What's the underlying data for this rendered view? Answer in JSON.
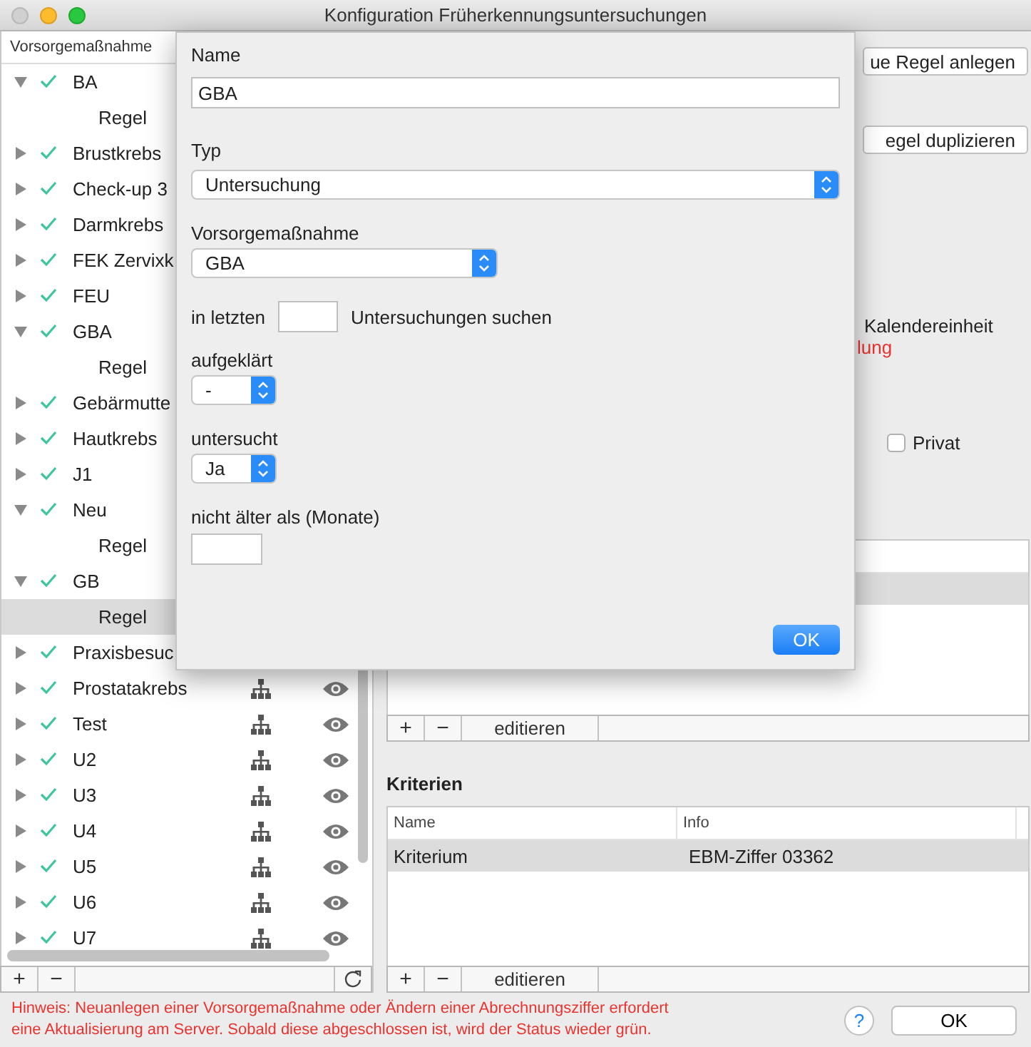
{
  "window": {
    "title": "Konfiguration Früherkennungsuntersuchungen"
  },
  "tree": {
    "column": "Vorsorgemaßnahme",
    "items": [
      {
        "label": "BA",
        "checked": true,
        "expanded": true,
        "selected": false,
        "icons": false,
        "children": [
          {
            "label": "Regel",
            "selected": false
          }
        ]
      },
      {
        "label": "Brustkrebs",
        "checked": true,
        "expanded": false,
        "selected": false,
        "icons": false
      },
      {
        "label": "Check-up 3",
        "checked": true,
        "expanded": false,
        "selected": false,
        "icons": false
      },
      {
        "label": "Darmkrebs",
        "checked": true,
        "expanded": false,
        "selected": false,
        "icons": false
      },
      {
        "label": "FEK Zervixk",
        "checked": true,
        "expanded": false,
        "selected": false,
        "icons": false
      },
      {
        "label": "FEU",
        "checked": true,
        "expanded": false,
        "selected": false,
        "icons": false
      },
      {
        "label": "GBA",
        "checked": true,
        "expanded": true,
        "selected": false,
        "icons": false,
        "children": [
          {
            "label": "Regel",
            "selected": false
          }
        ]
      },
      {
        "label": "Gebärmutte",
        "checked": true,
        "expanded": false,
        "selected": false,
        "icons": false
      },
      {
        "label": "Hautkrebs",
        "checked": true,
        "expanded": false,
        "selected": false,
        "icons": false
      },
      {
        "label": "J1",
        "checked": true,
        "expanded": false,
        "selected": false,
        "icons": false
      },
      {
        "label": "Neu",
        "checked": true,
        "expanded": true,
        "selected": false,
        "icons": false,
        "children": [
          {
            "label": "Regel",
            "selected": false
          }
        ]
      },
      {
        "label": "GB",
        "checked": true,
        "expanded": true,
        "selected": false,
        "icons": false,
        "children": [
          {
            "label": "Regel",
            "selected": true
          }
        ]
      },
      {
        "label": "Praxisbesuc",
        "checked": true,
        "expanded": false,
        "selected": false,
        "icons": false
      },
      {
        "label": "Prostatakrebs",
        "checked": true,
        "expanded": false,
        "selected": false,
        "icons": true
      },
      {
        "label": "Test",
        "checked": true,
        "expanded": false,
        "selected": false,
        "icons": true
      },
      {
        "label": "U2",
        "checked": true,
        "expanded": false,
        "selected": false,
        "icons": true
      },
      {
        "label": "U3",
        "checked": true,
        "expanded": false,
        "selected": false,
        "icons": true
      },
      {
        "label": "U4",
        "checked": true,
        "expanded": false,
        "selected": false,
        "icons": true
      },
      {
        "label": "U5",
        "checked": true,
        "expanded": false,
        "selected": false,
        "icons": true
      },
      {
        "label": "U6",
        "checked": true,
        "expanded": false,
        "selected": false,
        "icons": true
      },
      {
        "label": "U7",
        "checked": true,
        "expanded": false,
        "selected": false,
        "icons": true
      }
    ],
    "toolbar": {
      "add": "+",
      "remove": "−"
    }
  },
  "rules": {
    "new_button": "ue Regel anlegen",
    "duplicate_button": "egel duplizieren",
    "calendar_label": "Kalendereinheit",
    "warning_fragment": "lung",
    "private": {
      "label": "Privat",
      "checked": false
    },
    "table": {
      "rows": [
        {
          "selected": true
        }
      ]
    },
    "toolbar": {
      "add": "+",
      "remove": "−",
      "edit": "editieren"
    }
  },
  "criteria": {
    "title": "Kriterien",
    "columns": [
      "Name",
      "Info"
    ],
    "rows": [
      {
        "cells": [
          "Kriterium",
          "EBM-Ziffer 03362"
        ],
        "selected": true
      }
    ],
    "toolbar": {
      "add": "+",
      "remove": "−",
      "edit": "editieren"
    }
  },
  "footer": {
    "note": "Hinweis: Neuanlegen einer Vorsorgemaßnahme oder Ändern einer Abrechnungsziffer erfordert eine Aktualisierung am Server. Sobald diese abgeschlossen ist, wird der Status wieder grün.",
    "help": "?",
    "ok": "OK"
  },
  "sheet": {
    "name_label": "Name",
    "name_value": "GBA",
    "type_label": "Typ",
    "type_value": "Untersuchung",
    "measure_label": "Vorsorgemaßnahme",
    "measure_value": "GBA",
    "last_prefix": "in letzten",
    "last_suffix": "Untersuchungen suchen",
    "informed_label": "aufgeklärt",
    "informed_value": "-",
    "examined_label": "untersucht",
    "examined_value": "Ja",
    "age_label": "nicht älter als (Monate)",
    "ok": "OK"
  }
}
